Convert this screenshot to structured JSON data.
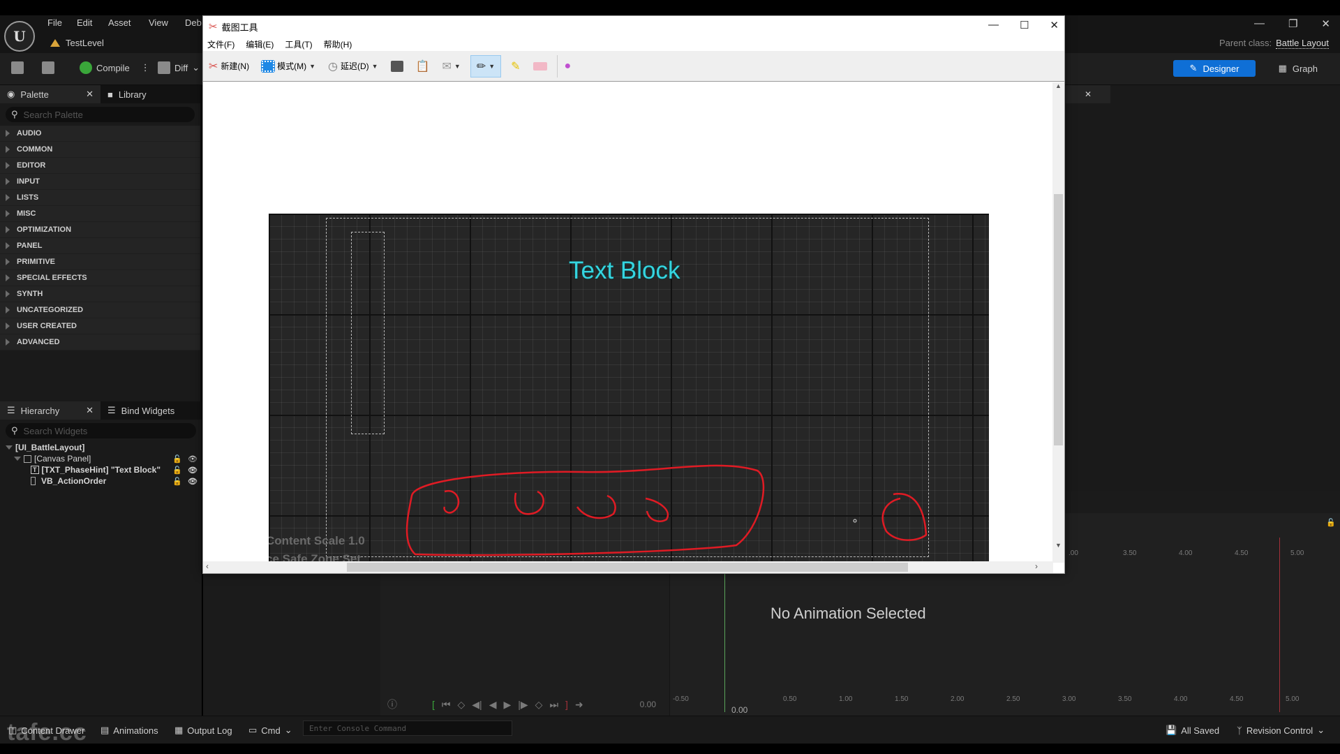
{
  "ue": {
    "menu": [
      "File",
      "Edit",
      "Asset",
      "View",
      "Deb"
    ],
    "level_name": "TestLevel",
    "parent_class_label": "Parent class:",
    "parent_class_value": "Battle Layout",
    "toolbar": {
      "compile_label": "Compile",
      "diff_label": "Diff",
      "designer_label": "Designer",
      "graph_label": "Graph"
    },
    "palette": {
      "tab_label": "Palette",
      "library_tab_label": "Library",
      "search_placeholder": "Search Palette",
      "categories": [
        "AUDIO",
        "COMMON",
        "EDITOR",
        "INPUT",
        "LISTS",
        "MISC",
        "OPTIMIZATION",
        "PANEL",
        "PRIMITIVE",
        "SPECIAL EFFECTS",
        "SYNTH",
        "UNCATEGORIZED",
        "USER CREATED",
        "ADVANCED"
      ]
    },
    "hierarchy": {
      "tab_label": "Hierarchy",
      "bind_tab_label": "Bind Widgets",
      "search_placeholder": "Search Widgets",
      "items": [
        {
          "label": "[UI_BattleLayout]"
        },
        {
          "label": "[Canvas Panel]"
        },
        {
          "label": "[TXT_PhaseHint] \"Text Block\""
        },
        {
          "label": "VB_ActionOrder"
        }
      ]
    },
    "animation": {
      "empty_message": "No Animation Selected",
      "current_time": "0.00",
      "playhead_time": "0.00",
      "ticks": [
        "-0.50",
        "0.50",
        "1.00",
        "1.50",
        "2.00",
        "2.50",
        "3.00",
        "3.50",
        "4.00",
        "4.50",
        "5.00"
      ],
      "top_ticks": [
        ".00",
        "3.50",
        "4.00",
        "4.50",
        "5.00"
      ]
    },
    "statusbar": {
      "content_drawer": "Content Drawer",
      "animations": "Animations",
      "output_log": "Output Log",
      "cmd": "Cmd",
      "console_placeholder": "Enter Console Command",
      "all_saved": "All Saved",
      "revision_control": "Revision Control"
    },
    "watermark": "tafe.cc"
  },
  "snip": {
    "title": "截图工具",
    "menu": [
      "文件(F)",
      "编辑(E)",
      "工具(T)",
      "帮助(H)"
    ],
    "tools": {
      "new_label": "新建(N)",
      "mode_label": "模式(M)",
      "delay_label": "延迟(D)"
    },
    "capture": {
      "text_block": "Text Block",
      "info_line1": "Content Scale 1.0",
      "info_line2": "ce Safe Zone Set"
    },
    "colors": {
      "pen": "#e01b24",
      "text_block": "#35d5e0",
      "accent": "#0f6fd6"
    }
  }
}
